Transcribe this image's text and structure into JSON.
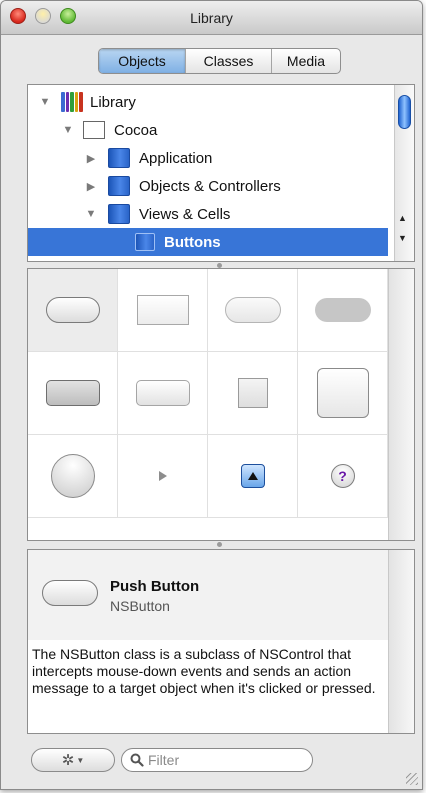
{
  "window": {
    "title": "Library"
  },
  "tabs": [
    {
      "label": "Objects",
      "selected": true
    },
    {
      "label": "Classes",
      "selected": false
    },
    {
      "label": "Media",
      "selected": false
    }
  ],
  "tree": [
    {
      "label": "Library",
      "expanded": true,
      "icon": "library-books-icon"
    },
    {
      "label": "Cocoa",
      "expanded": true,
      "icon": "white-folder-icon"
    },
    {
      "label": "Application",
      "expanded": false,
      "icon": "blue-folder-icon"
    },
    {
      "label": "Objects & Controllers",
      "expanded": false,
      "icon": "blue-folder-icon"
    },
    {
      "label": "Views & Cells",
      "expanded": true,
      "icon": "blue-folder-icon"
    },
    {
      "label": "Buttons",
      "selected": true,
      "icon": "blue-folder-icon"
    }
  ],
  "palette": [
    {
      "name": "push-button",
      "selected": true
    },
    {
      "name": "square-button"
    },
    {
      "name": "rounded-rect-button"
    },
    {
      "name": "recessed-button"
    },
    {
      "name": "textured-rounded-button"
    },
    {
      "name": "gradient-button"
    },
    {
      "name": "bevel-button"
    },
    {
      "name": "large-bevel-button"
    },
    {
      "name": "round-button"
    },
    {
      "name": "disclosure-triangle"
    },
    {
      "name": "disclosure-button"
    },
    {
      "name": "help-button"
    }
  ],
  "info": {
    "name": "Push Button",
    "class": "NSButton",
    "description": "The NSButton class is a subclass of NSControl that intercepts mouse-down events and sends an action message to a target object when it's clicked or pressed."
  },
  "bottom": {
    "filter_placeholder": "Filter",
    "action_icon": "gear-icon"
  },
  "colors": {
    "selection": "#3875d7",
    "folder_blue": "#2a64c8"
  }
}
